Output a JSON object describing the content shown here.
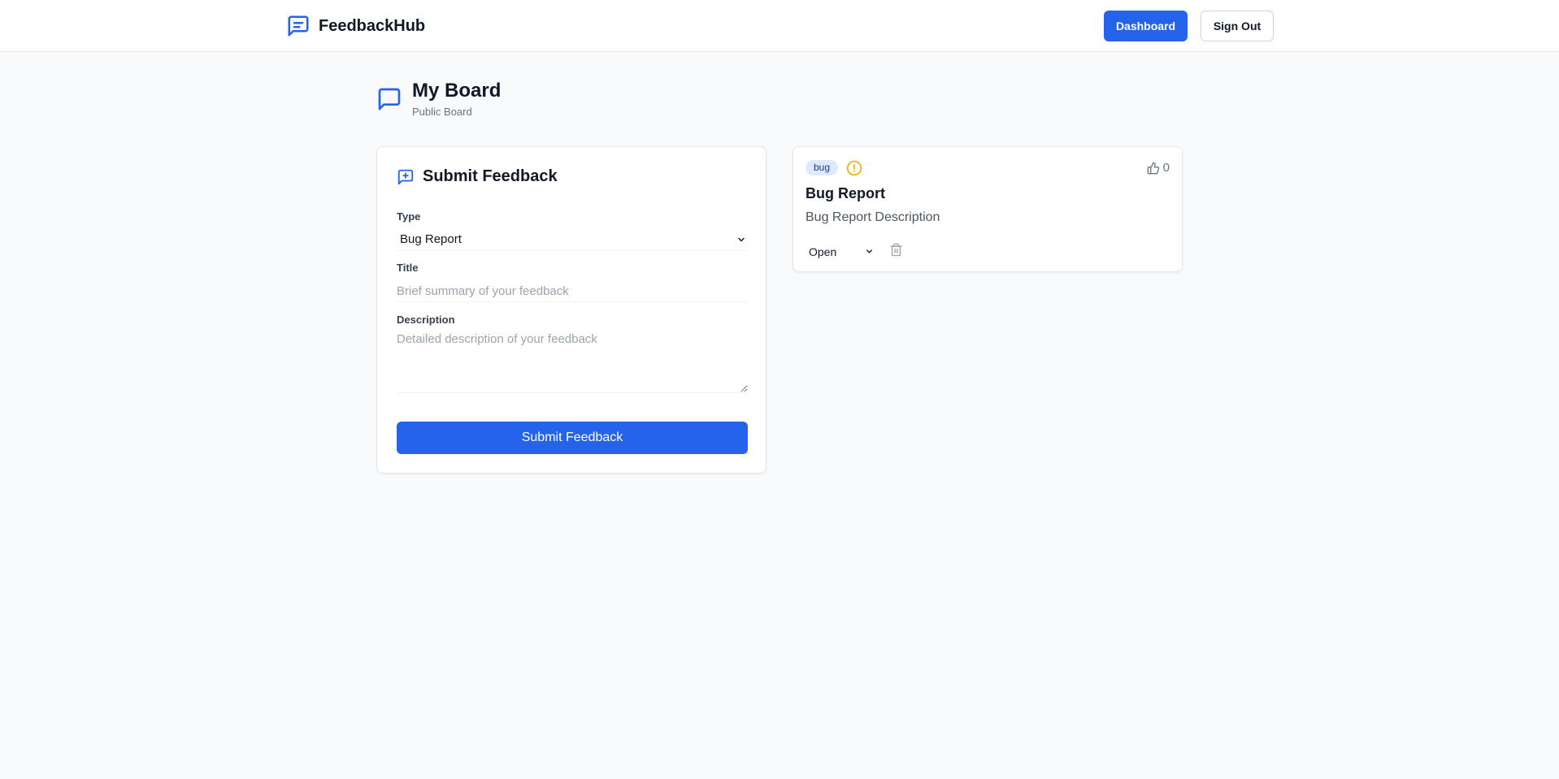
{
  "header": {
    "brand_name": "FeedbackHub",
    "dashboard_label": "Dashboard",
    "signout_label": "Sign Out"
  },
  "board": {
    "title": "My Board",
    "subtitle": "Public Board"
  },
  "form": {
    "title": "Submit Feedback",
    "type_label": "Type",
    "type_value": "Bug Report",
    "title_label": "Title",
    "title_placeholder": "Brief summary of your feedback",
    "description_label": "Description",
    "description_placeholder": "Detailed description of your feedback",
    "submit_label": "Submit Feedback"
  },
  "feedback_items": [
    {
      "tag": "bug",
      "title": "Bug Report",
      "description": "Bug Report Description",
      "votes": "0",
      "status": "Open"
    }
  ],
  "colors": {
    "accent": "#2563eb",
    "page_bg": "#f8fafc",
    "warning": "#eab308",
    "tag_bg": "#dbeafe"
  },
  "icons": {
    "brand": "message-square-text-icon",
    "board": "message-square-icon",
    "form": "message-square-plus-icon",
    "priority": "alert-circle-icon",
    "vote": "thumbs-up-icon",
    "delete": "trash-icon"
  }
}
